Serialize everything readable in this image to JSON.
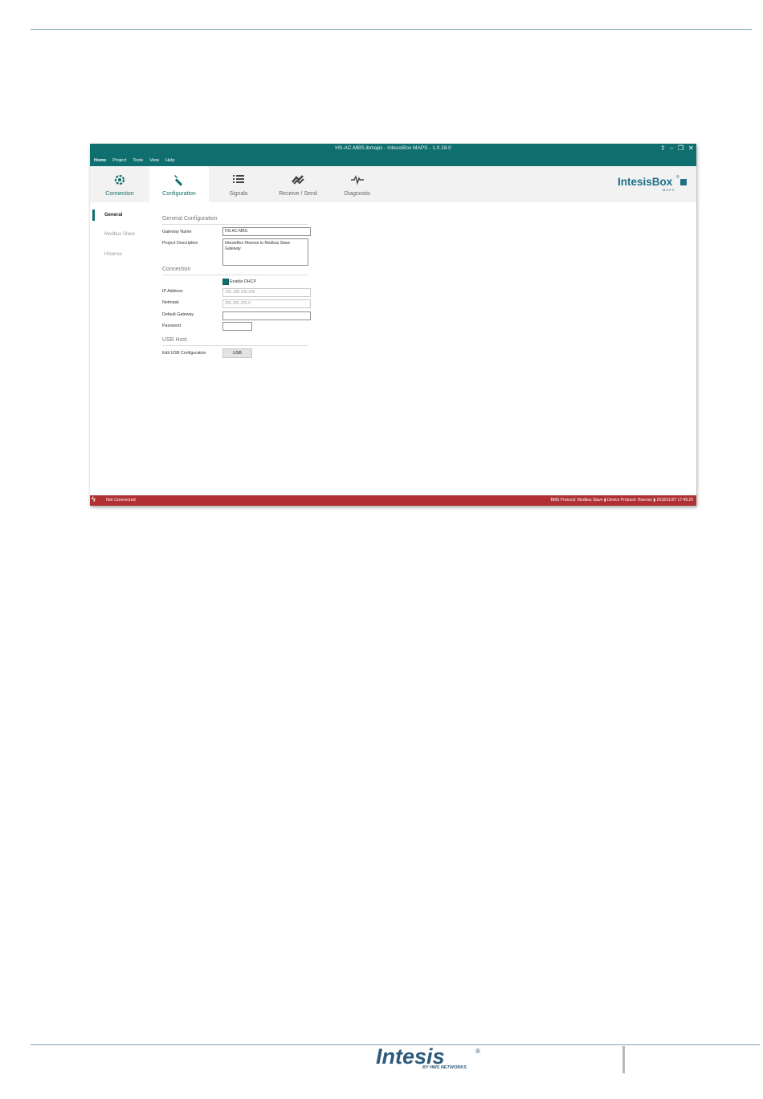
{
  "window": {
    "title": "HS-AC-MBS.ibmaps - IntesisBox MAPS - 1.0.18.0",
    "controls": {
      "upload": "⇪",
      "minimize": "–",
      "restore": "❐",
      "close": "✕"
    }
  },
  "menu": [
    "Home",
    "Project",
    "Tools",
    "View",
    "Help"
  ],
  "tabs": [
    {
      "label": "Connection",
      "icon": "connection-gear-icon"
    },
    {
      "label": "Configuration",
      "icon": "wrench-icon"
    },
    {
      "label": "Signals",
      "icon": "list-icon"
    },
    {
      "label": "Receive / Send",
      "icon": "transfer-icon"
    },
    {
      "label": "Diagnostic",
      "icon": "pulse-icon"
    }
  ],
  "brand": {
    "name": "IntesisBox",
    "reg": "®",
    "sub": "MAPS"
  },
  "sidebar": [
    "General",
    "Modbus Slave",
    "Hisense"
  ],
  "general": {
    "section_title": "General Configuration",
    "gateway_name_label": "Gateway Name",
    "gateway_name_value": "HS-AC-MBS",
    "project_desc_label": "Project Description",
    "project_desc_value": "IntesisBox Hisense to Modbus Slave Gateway"
  },
  "connection": {
    "section_title": "Connection",
    "dhcp_label": "Enable DHCP",
    "dhcp_checked": true,
    "ip_label": "IP Address",
    "ip_value": "192.168.100.246",
    "netmask_label": "Netmask",
    "netmask_value": "255.255.255.0",
    "gateway_label": "Default Gateway",
    "gateway_value": "",
    "password_label": "Password",
    "password_value": ""
  },
  "usb": {
    "section_title": "USB Host",
    "edit_label": "Edit USB Configuration",
    "button_label": "USB"
  },
  "status": {
    "connection": "Not Connected",
    "right": "BMS Protocol: Modbus Slave  ▮  Device Protocol: Hisense  ▮  2018/11/07 17:49:20"
  },
  "footer": {
    "logo": "Intesis",
    "reg": "®",
    "sub": "BY HMS NETWORKS"
  },
  "colors": {
    "teal": "#0f6f6e",
    "status_red": "#b03033",
    "brand_blue": "#1f6f86"
  }
}
